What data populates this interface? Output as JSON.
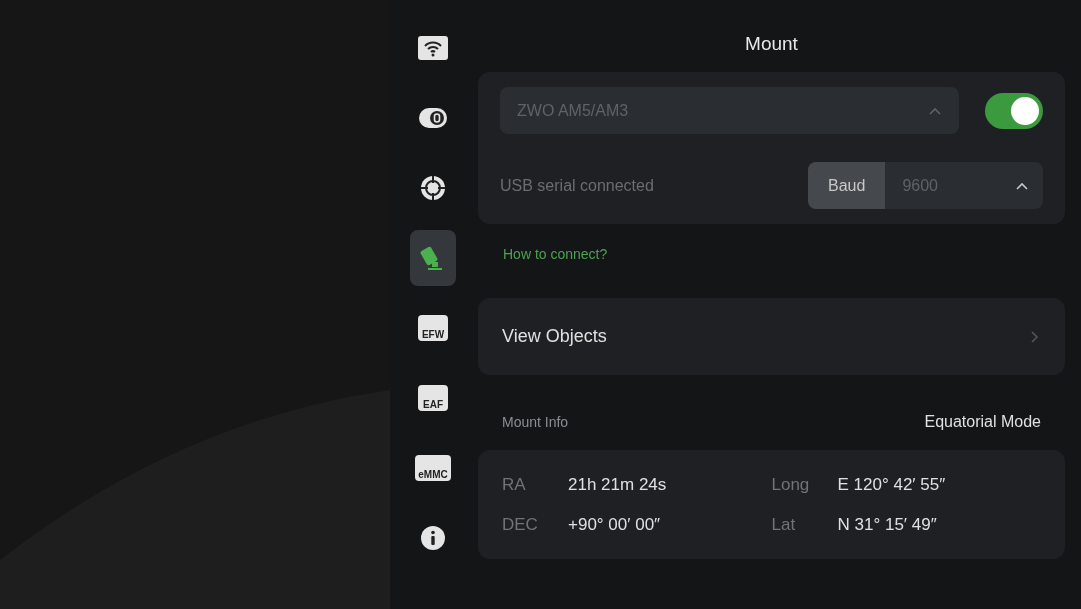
{
  "sidebar": {
    "items": [
      {
        "kind": "wifi",
        "selected": false
      },
      {
        "kind": "camera",
        "selected": false
      },
      {
        "kind": "guide",
        "selected": false
      },
      {
        "kind": "mount",
        "selected": true
      },
      {
        "kind": "efw",
        "label": "EFW",
        "selected": false
      },
      {
        "kind": "eaf",
        "label": "EAF",
        "selected": false
      },
      {
        "kind": "emmc",
        "label": "eMMC",
        "selected": false
      },
      {
        "kind": "info",
        "selected": false
      }
    ]
  },
  "title": "Mount",
  "connection": {
    "device": "ZWO AM5/AM3",
    "on": true,
    "status": "USB serial connected",
    "baud_label": "Baud",
    "baud_value": "9600"
  },
  "help_link": "How to connect?",
  "view_objects": "View Objects",
  "mount_info": {
    "label": "Mount Info",
    "mode": "Equatorial Mode",
    "fields": [
      {
        "label": "RA",
        "value": "21h 21m 24s"
      },
      {
        "label": "Long",
        "value": "E 120° 42′ 55″"
      },
      {
        "label": "DEC",
        "value": "+90° 00′ 00″"
      },
      {
        "label": "Lat",
        "value": "N 31° 15′ 49″"
      }
    ]
  }
}
